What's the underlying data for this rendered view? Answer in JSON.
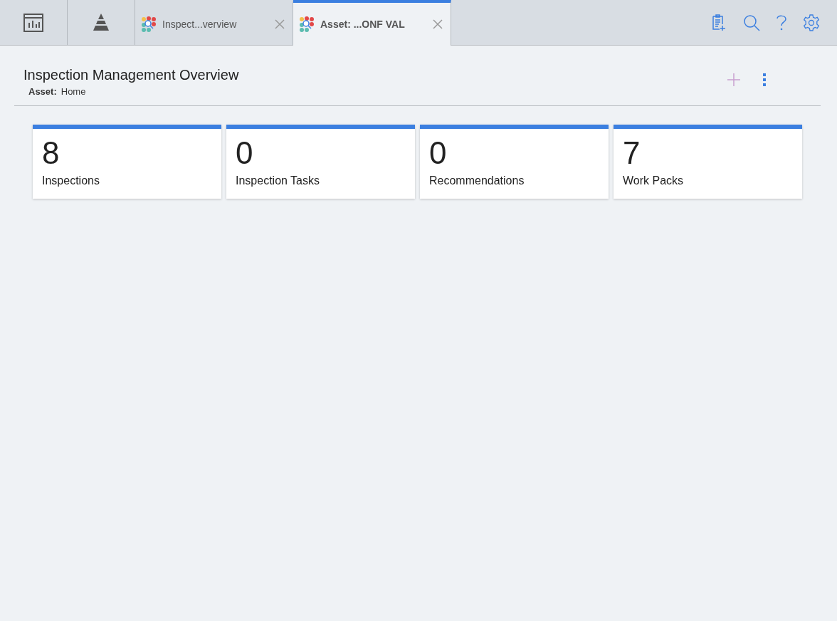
{
  "tabs": [
    {
      "kind": "icon",
      "selected": false
    },
    {
      "kind": "icon",
      "selected": false
    },
    {
      "kind": "document",
      "label": "Inspect...verview",
      "selected": false
    },
    {
      "kind": "document",
      "label": "Asset: ...ONF VAL",
      "selected": true
    }
  ],
  "page": {
    "title": "Inspection Management Overview",
    "breadcrumb": {
      "label": "Asset:",
      "value": "Home"
    }
  },
  "tiles": [
    {
      "count": "8",
      "label": "Inspections"
    },
    {
      "count": "0",
      "label": "Inspection Tasks"
    },
    {
      "count": "0",
      "label": "Recommendations"
    },
    {
      "count": "7",
      "label": "Work Packs"
    }
  ]
}
